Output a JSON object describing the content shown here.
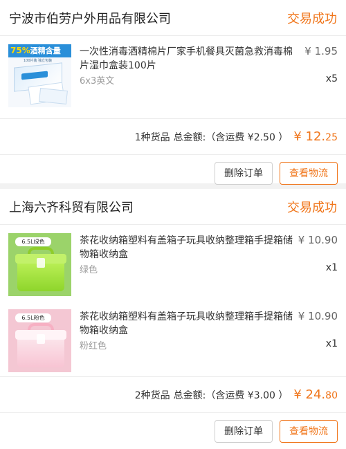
{
  "orders": [
    {
      "shop_name": "宁波市伯劳户外用品有限公司",
      "status": "交易成功",
      "items": [
        {
          "title": "一次性消毒酒精棉片厂家手机餐具灭菌急救消毒棉片湿巾盒装100片",
          "spec": "6x3英文",
          "price": "¥ 1.95",
          "qty": "x5",
          "thumb_text": {
            "pct": "75%",
            "label": "酒精含量",
            "sub": "100片装 独立包装"
          }
        }
      ],
      "summary": {
        "count_text": "1种货品",
        "total_label": "总金额:（含运费 ¥2.50 ）",
        "currency": "¥",
        "total_int": "12.",
        "total_dec": "25"
      },
      "actions": {
        "delete": "删除订单",
        "logistics": "查看物流"
      }
    },
    {
      "shop_name": "上海六齐科贸有限公司",
      "status": "交易成功",
      "items": [
        {
          "title": "茶花收纳箱塑料有盖箱子玩具收纳整理箱手提箱储物箱收纳盒",
          "spec": "绿色",
          "price": "¥ 10.90",
          "qty": "x1",
          "thumb_tag": "6.5L绿色"
        },
        {
          "title": "茶花收纳箱塑料有盖箱子玩具收纳整理箱手提箱储物箱收纳盒",
          "spec": "粉红色",
          "price": "¥ 10.90",
          "qty": "x1",
          "thumb_tag": "6.5L粉色"
        }
      ],
      "summary": {
        "count_text": "2种货品",
        "total_label": "总金额:（含运费 ¥3.00 ）",
        "currency": "¥",
        "total_int": "24.",
        "total_dec": "80"
      },
      "actions": {
        "delete": "删除订单",
        "logistics": "查看物流"
      }
    }
  ],
  "colors": {
    "accent": "#f0751a",
    "muted_text": "#999999",
    "background": "#f2f2f2"
  }
}
